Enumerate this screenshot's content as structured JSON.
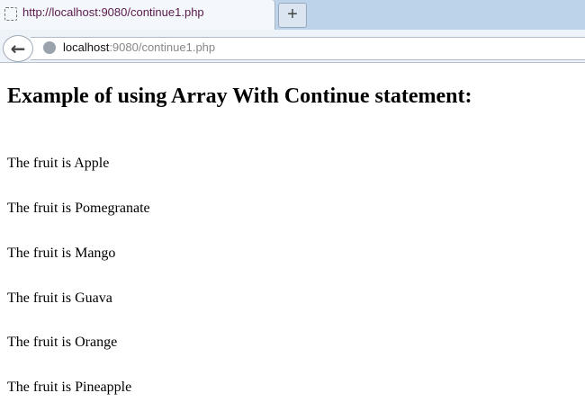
{
  "browser": {
    "tab_title": "http://localhost:9080/continue1.php",
    "new_tab": "+",
    "url_host": "localhost",
    "url_rest": ":9080/continue1.php"
  },
  "page": {
    "heading": "Example of using Array With Continue statement:",
    "lines": [
      "The fruit is Apple",
      "The fruit is Pomegranate",
      "The fruit is Mango",
      "The fruit is Guava",
      "The fruit is Orange",
      "The fruit is Pineapple"
    ]
  }
}
